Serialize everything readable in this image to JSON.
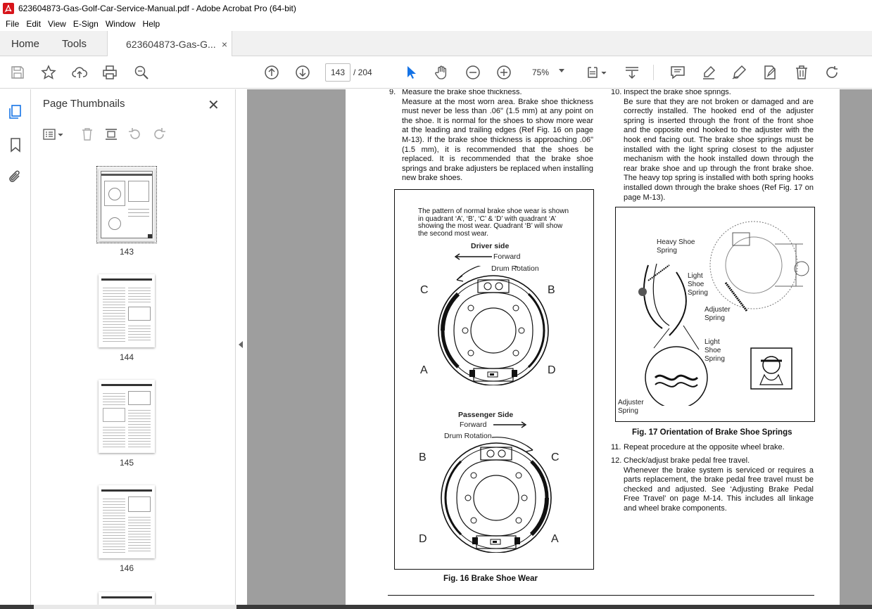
{
  "window": {
    "title": "623604873-Gas-Golf-Car-Service-Manual.pdf - Adobe Acrobat Pro (64-bit)"
  },
  "menu": [
    "File",
    "Edit",
    "View",
    "E-Sign",
    "Window",
    "Help"
  ],
  "tabs": {
    "home": "Home",
    "tools": "Tools",
    "doc": "623604873-Gas-G...",
    "close": "×"
  },
  "toolbar": {
    "page_current": "143",
    "page_total": "/  204",
    "zoom": "75%"
  },
  "thumbnails": {
    "title": "Page Thumbnails",
    "close": "✕",
    "pages": [
      "143",
      "144",
      "145",
      "146"
    ]
  },
  "document": {
    "step9_num": "9.",
    "step9_head": "Measure the brake shoe thickness.",
    "step9_body": "Measure at the most worn area. Brake shoe thickness must never be less than .06\" (1.5 mm) at any point on the shoe. It is normal for the shoes to show more wear at the leading and trailing edges (Ref Fig. 16 on page M-13). If the brake shoe thickness is approaching .06\" (1.5 mm), it is recommended that the shoes be replaced. It is recommended that the brake shoe springs and brake adjusters be replaced when installing new brake shoes.",
    "step10_num": "10.",
    "step10_head": "Inspect the brake shoe springs.",
    "step10_body": "Be sure that they are not broken or damaged and are correctly installed. The hooked end of the adjuster spring is inserted through the front of the front shoe and the opposite end hooked to the adjuster with the hook end facing out. The brake shoe springs must be installed with the light spring closest to the adjuster mechanism with the hook installed down through the rear brake shoe and up through the front brake shoe. The heavy top spring is installed with both spring hooks installed down through the brake shoes (Ref Fig. 17 on page M-13).",
    "fig16_note": "The pattern of normal brake shoe wear is shown in quadrant ‘A’, ‘B’, ‘C’ & ‘D’ with quadrant ‘A’ showing the most wear. Quadrant ‘B’ will show the second most wear.",
    "fig16_driver": "Driver side",
    "fig16_forward": "Forward",
    "fig16_drum": "Drum Rotation",
    "fig16_passenger": "Passenger Side",
    "fig16_caption": "Fig. 16  Brake Shoe Wear",
    "quad_top": {
      "c": "C",
      "b": "B",
      "a": "A",
      "d": "D"
    },
    "quad_bottom": {
      "b": "B",
      "c": "C",
      "d": "D",
      "a": "A"
    },
    "fig17_heavy": "Heavy Shoe Spring",
    "fig17_light1": "Light Shoe Spring",
    "fig17_adjuster1": "Adjuster Spring",
    "fig17_light2": "Light Shoe Spring",
    "fig17_adjuster2": "Adjuster Spring",
    "fig17_caption": "Fig. 17  Orientation of Brake Shoe Springs",
    "step11_num": "11.",
    "step11": "Repeat procedure at the opposite wheel brake.",
    "step12_num": "12.",
    "step12_head": "Check/adjust brake pedal free travel.",
    "step12_body": "Whenever the brake system is serviced or requires a parts replacement, the brake pedal free travel must be checked and adjusted. See ‘Adjusting Brake Pedal Free Travel’ on page M-14. This includes all linkage and wheel brake components."
  }
}
